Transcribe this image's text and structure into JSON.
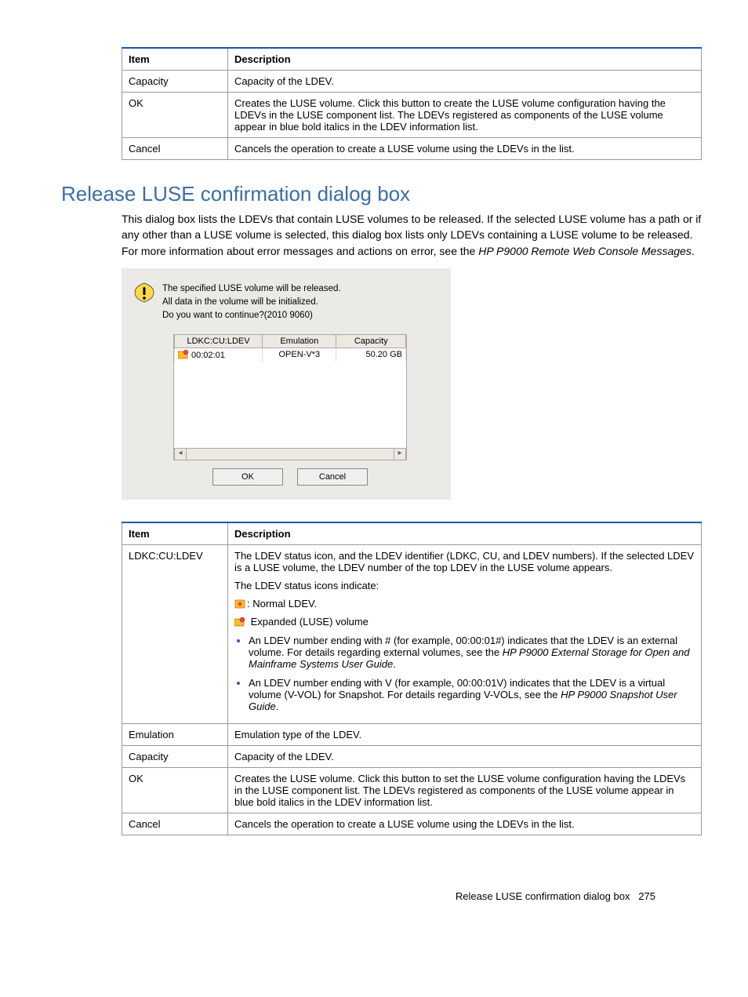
{
  "table1": {
    "headers": {
      "item": "Item",
      "desc": "Description"
    },
    "rows": [
      {
        "item": "Capacity",
        "desc": "Capacity of the LDEV."
      },
      {
        "item": "OK",
        "desc": "Creates the LUSE volume. Click this button to create the LUSE volume configuration having the LDEVs in the LUSE component list. The LDEVs registered as components of the LUSE volume appear in blue bold italics in the LDEV information list."
      },
      {
        "item": "Cancel",
        "desc": "Cancels the operation to create a LUSE volume using the LDEVs in the list."
      }
    ]
  },
  "heading": "Release LUSE confirmation dialog box",
  "paragraph": {
    "pre": "This dialog box lists the LDEVs that contain LUSE volumes to be released. If the selected LUSE volume has a path or if any other than a LUSE volume is selected, this dialog box lists only LDEVs containing a LUSE volume to be released. For more information about error messages and actions on error, see the ",
    "ref": "HP P9000 Remote Web Console Messages",
    "post": "."
  },
  "dialog": {
    "msg_l1": "The specified LUSE volume will be released.",
    "msg_l2": "All data in the volume will be initialized.",
    "msg_l3": "Do you want to continue?(2010 9060)",
    "th1": "LDKC:CU:LDEV",
    "th2": "Emulation",
    "th3": "Capacity",
    "td1": "00:02:01",
    "td2": "OPEN-V*3",
    "td3": "50.20 GB",
    "ok": "OK",
    "cancel": "Cancel"
  },
  "table2": {
    "headers": {
      "item": "Item",
      "desc": "Description"
    },
    "row1": {
      "item": "LDKC:CU:LDEV",
      "p1": "The LDEV status icon, and the LDEV identifier (LDKC, CU, and LDEV numbers). If the selected LDEV is a LUSE volume, the LDEV number of the top LDEV in the LUSE volume appears.",
      "p2": "The LDEV status icons indicate:",
      "icon1_label": ": Normal LDEV.",
      "icon2_label": " Expanded (LUSE) volume",
      "li1_pre": "An LDEV number ending with # (for example, 00:00:01#) indicates that the LDEV is an external volume. For details regarding external volumes, see the ",
      "li1_ref": "HP P9000 External Storage for Open and Mainframe Systems User Guide",
      "li1_post": ".",
      "li2_pre": "An LDEV number ending with V (for example, 00:00:01V) indicates that the LDEV is a virtual volume (V-VOL) for Snapshot. For details regarding V-VOLs, see the ",
      "li2_ref": "HP P9000 Snapshot User Guide",
      "li2_post": "."
    },
    "row2": {
      "item": "Emulation",
      "desc": "Emulation type of the LDEV."
    },
    "row3": {
      "item": "Capacity",
      "desc": "Capacity of the LDEV."
    },
    "row4": {
      "item": "OK",
      "desc": "Creates the LUSE volume. Click this button to set the LUSE volume configuration having the LDEVs in the LUSE component list. The LDEVs registered as components of the LUSE volume appear in blue bold italics in the LDEV information list."
    },
    "row5": {
      "item": "Cancel",
      "desc": "Cancels the operation to create a LUSE volume using the LDEVs in the list."
    }
  },
  "footer": {
    "title": "Release LUSE confirmation dialog box",
    "page": "275"
  }
}
